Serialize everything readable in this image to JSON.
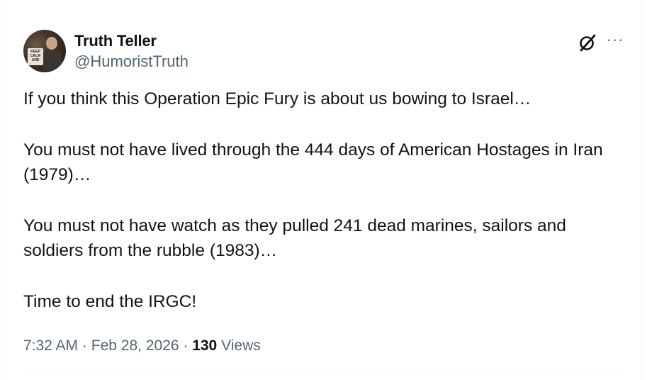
{
  "author": {
    "display_name": "Truth Teller",
    "handle": "@HumoristTruth",
    "avatar_poster_text": "KEEP CALM AND"
  },
  "header_icons": {
    "grok": "grok-icon",
    "more": "more-icon",
    "more_glyph": "···"
  },
  "tweet": {
    "paragraphs": [
      "If you think this Operation Epic Fury is about us bowing to Israel…",
      "You must not have lived through the 444 days of American Hostages in Iran (1979)…",
      "You must not have watch as they pulled 241 dead marines, sailors and soldiers from the rubble (1983)…",
      "Time to end the IRGC!"
    ]
  },
  "meta": {
    "time": "7:32 AM",
    "separator": "·",
    "date": "Feb 28, 2026",
    "views_count": "130",
    "views_label": "Views"
  },
  "colors": {
    "text_primary": "#0f1419",
    "text_secondary": "#536471",
    "border": "#eff3f4"
  }
}
